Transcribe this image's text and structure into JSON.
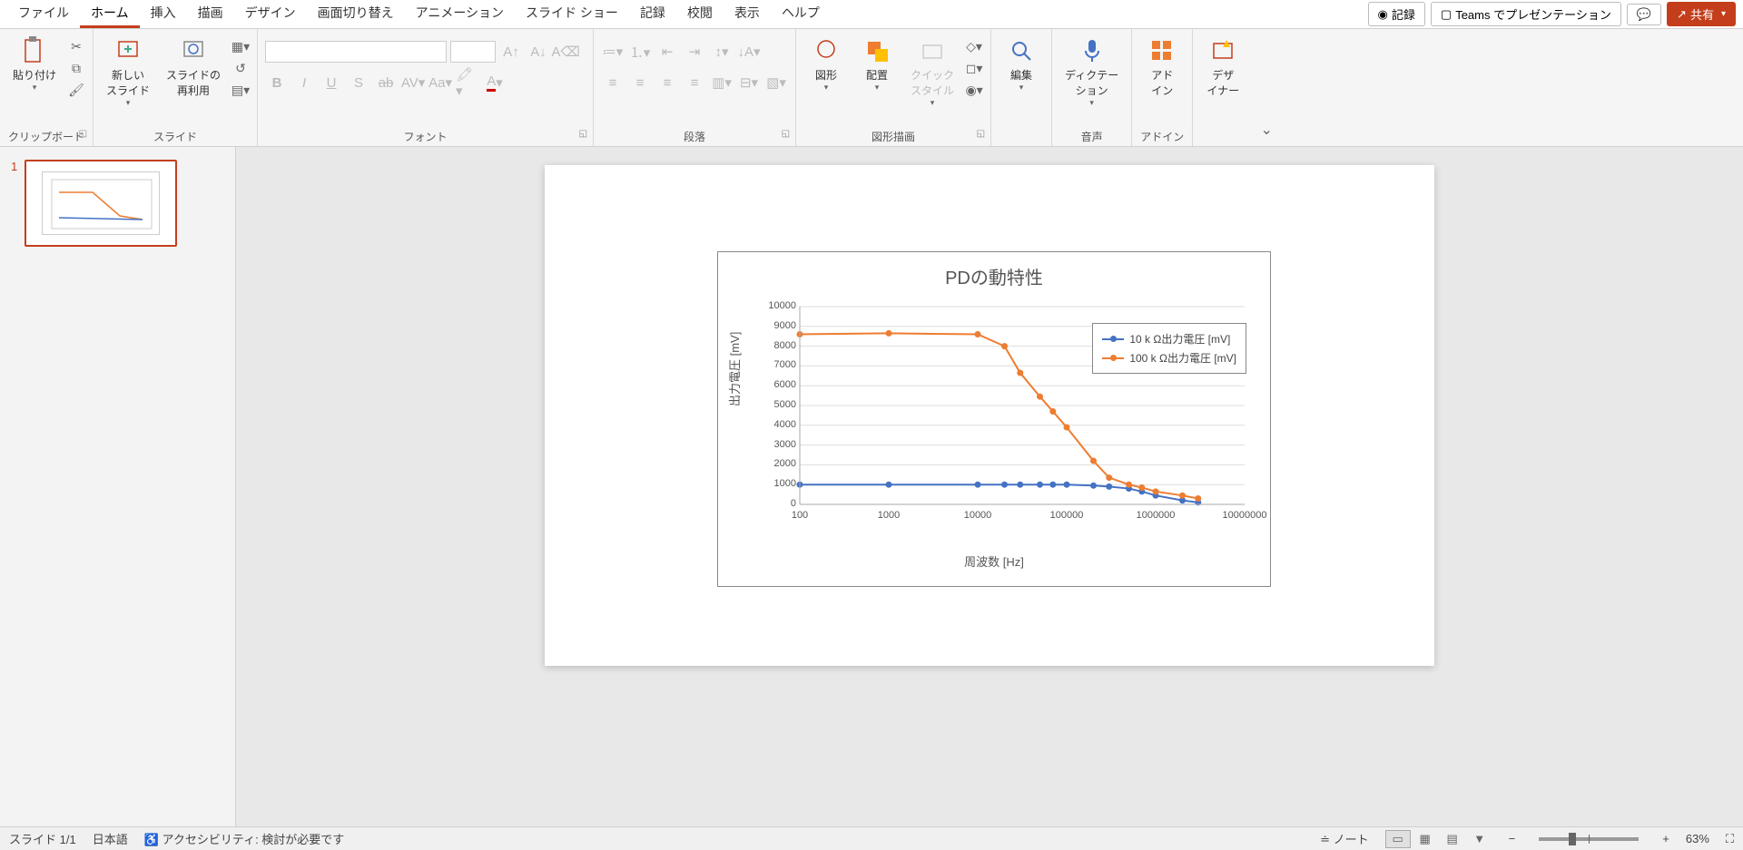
{
  "menu": {
    "tabs": [
      "ファイル",
      "ホーム",
      "挿入",
      "描画",
      "デザイン",
      "画面切り替え",
      "アニメーション",
      "スライド ショー",
      "記録",
      "校閲",
      "表示",
      "ヘルプ"
    ],
    "active_index": 1,
    "record": "記録",
    "teams": "Teams でプレゼンテーション",
    "share": "共有"
  },
  "ribbon": {
    "clipboard": {
      "paste": "貼り付け",
      "label": "クリップボード"
    },
    "slides": {
      "new": "新しい\nスライド",
      "reuse": "スライドの\n再利用",
      "label": "スライド"
    },
    "font_label": "フォント",
    "paragraph_label": "段落",
    "drawing": {
      "shapes": "図形",
      "arrange": "配置",
      "quick": "クイック\nスタイル",
      "label": "図形描画"
    },
    "editing": "編集",
    "dictate": "ディクテー\nション",
    "voice_label": "音声",
    "addin": "アド\nイン",
    "addin_label": "アドイン",
    "designer": "デザ\nイナー"
  },
  "thumb": {
    "num": "1"
  },
  "status": {
    "slide": "スライド 1/1",
    "lang": "日本語",
    "a11y": "アクセシビリティ: 検討が必要です",
    "notes": "ノート",
    "zoom": "63%"
  },
  "chart_data": {
    "type": "line",
    "title": "PDの動特性",
    "xlabel": "周波数 [Hz]",
    "ylabel": "出力電圧 [mV]",
    "xscale": "log",
    "xlim": [
      100,
      10000000
    ],
    "ylim": [
      0,
      10000
    ],
    "yticks": [
      0,
      1000,
      2000,
      3000,
      4000,
      5000,
      6000,
      7000,
      8000,
      9000,
      10000
    ],
    "xticks": [
      100,
      1000,
      10000,
      100000,
      1000000,
      10000000
    ],
    "series": [
      {
        "name": "10 k Ω出力電圧 [mV]",
        "color": "#4472c4",
        "x": [
          100,
          1000,
          10000,
          20000,
          30000,
          50000,
          70000,
          100000,
          200000,
          300000,
          500000,
          700000,
          1000000,
          2000000,
          3000000
        ],
        "y": [
          1000,
          1000,
          1000,
          1000,
          1000,
          1000,
          1000,
          1000,
          950,
          900,
          800,
          650,
          450,
          200,
          100
        ]
      },
      {
        "name": "100 k Ω出力電圧 [mV]",
        "color": "#ed7d31",
        "x": [
          100,
          1000,
          10000,
          20000,
          30000,
          50000,
          70000,
          100000,
          200000,
          300000,
          500000,
          700000,
          1000000,
          2000000,
          3000000
        ],
        "y": [
          8600,
          8650,
          8600,
          8000,
          6650,
          5450,
          4700,
          3900,
          2200,
          1350,
          1000,
          850,
          650,
          450,
          300
        ]
      }
    ]
  }
}
